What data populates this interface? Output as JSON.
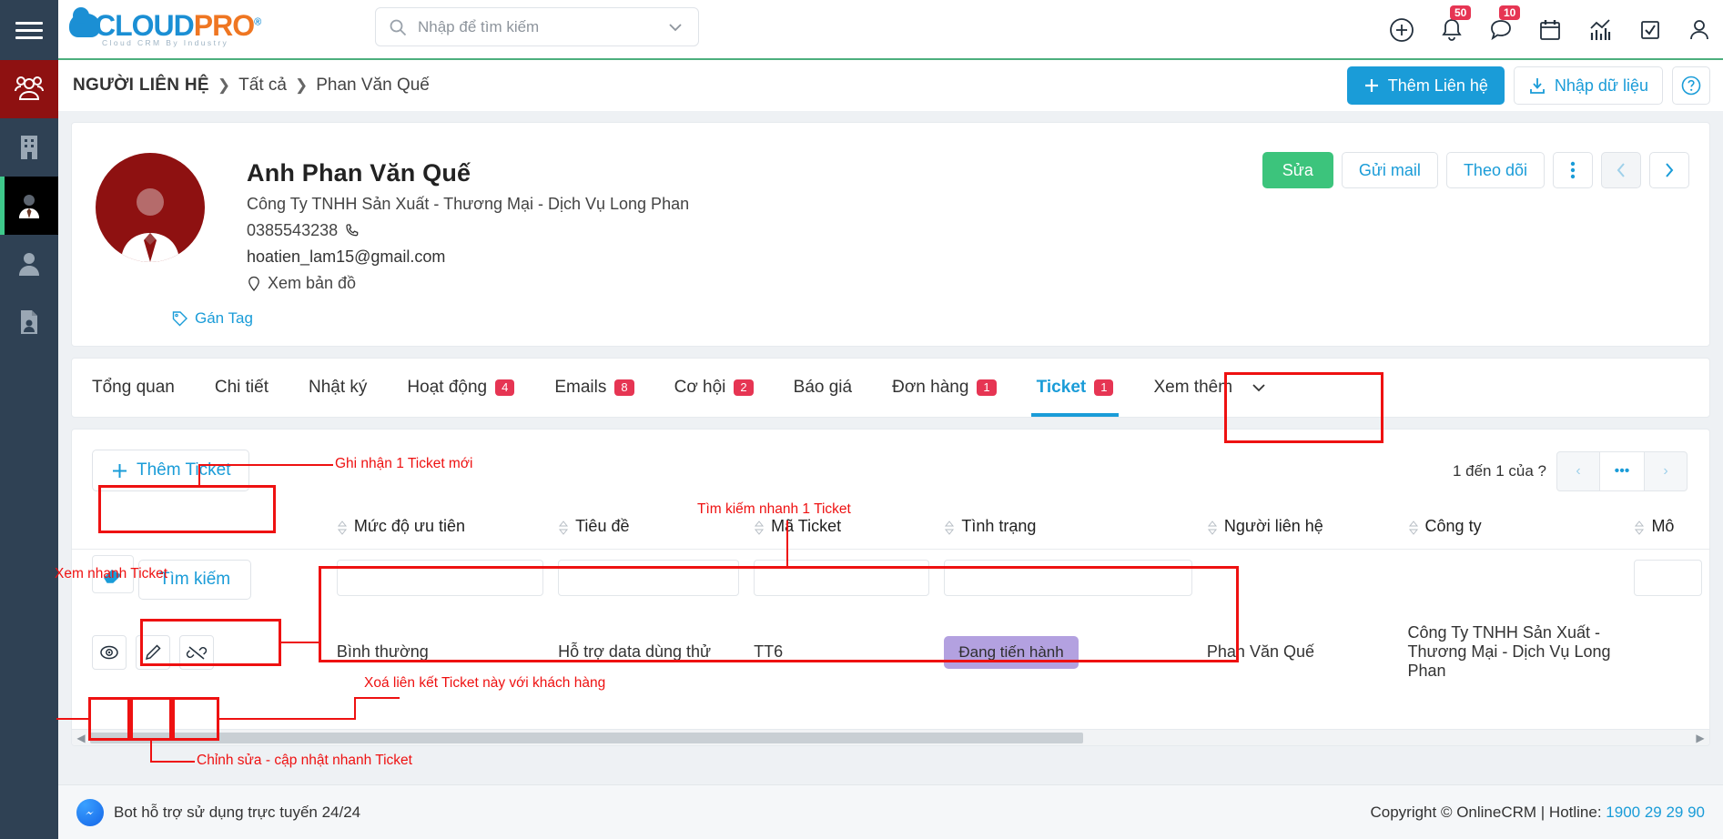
{
  "rail": {
    "items": [
      {
        "name": "menu-toggle",
        "icon": "hamburger-icon"
      },
      {
        "name": "contacts",
        "icon": "people-group-icon",
        "state": "active-red"
      },
      {
        "name": "companies",
        "icon": "building-icon",
        "state": "normal"
      },
      {
        "name": "persons",
        "icon": "person-tie-icon",
        "state": "active-black"
      },
      {
        "name": "users",
        "icon": "user-icon",
        "state": "normal"
      },
      {
        "name": "documents",
        "icon": "document-person-icon",
        "state": "normal"
      }
    ]
  },
  "header": {
    "logo_main": "CLOUD",
    "logo_accent": "PRO",
    "logo_reg": "®",
    "logo_tagline": "Cloud CRM By Industry",
    "search_placeholder": "Nhập để tìm kiếm",
    "search_value": "",
    "icons": [
      {
        "name": "add-circle-icon",
        "badge": null
      },
      {
        "name": "bell-icon",
        "badge": "50"
      },
      {
        "name": "chat-bubble-icon",
        "badge": "10"
      },
      {
        "name": "calendar-icon",
        "badge": null
      },
      {
        "name": "analytics-icon",
        "badge": null
      },
      {
        "name": "task-check-icon",
        "badge": null
      },
      {
        "name": "account-icon",
        "badge": null
      }
    ]
  },
  "breadcrumb": {
    "title": "NGƯỜI LIÊN HỆ",
    "sep": "❯",
    "items": [
      "Tất cả",
      "Phan Văn Quế"
    ],
    "actions": {
      "add_label": "Thêm Liên hệ",
      "import_label": "Nhập dữ liệu",
      "help_label": "?"
    }
  },
  "profile": {
    "name": "Anh Phan Văn Quế",
    "company": "Công Ty TNHH Sản Xuất - Thương Mại - Dịch Vụ Long Phan",
    "phone": "0385543238",
    "email": "hoatien_lam15@gmail.com",
    "map_label": "Xem bản đồ",
    "tag_label": "Gán Tag",
    "actions": {
      "edit": "Sửa",
      "send_mail": "Gửi mail",
      "follow": "Theo dõi",
      "more": "⋮",
      "prev": "‹",
      "next": "›"
    }
  },
  "tabs": [
    {
      "label": "Tổng quan",
      "badge": null,
      "active": false
    },
    {
      "label": "Chi tiết",
      "badge": null,
      "active": false
    },
    {
      "label": "Nhật ký",
      "badge": null,
      "active": false
    },
    {
      "label": "Hoạt động",
      "badge": "4",
      "active": false
    },
    {
      "label": "Emails",
      "badge": "8",
      "active": false
    },
    {
      "label": "Cơ hội",
      "badge": "2",
      "active": false
    },
    {
      "label": "Báo giá",
      "badge": null,
      "active": false
    },
    {
      "label": "Đơn hàng",
      "badge": "1",
      "active": false
    },
    {
      "label": "Ticket",
      "badge": "1",
      "active": true
    },
    {
      "label": "Xem thêm",
      "badge": null,
      "active": false
    }
  ],
  "panel": {
    "add_ticket_label": "Thêm Ticket",
    "search_button_label": "Tìm kiếm",
    "pagination": {
      "label": "1 đến 1 của ?",
      "prev": "‹",
      "mid": "•••",
      "next": "›"
    },
    "columns": [
      {
        "key": "actions",
        "label": ""
      },
      {
        "key": "priority",
        "label": "Mức độ ưu tiên"
      },
      {
        "key": "title",
        "label": "Tiêu đề"
      },
      {
        "key": "code",
        "label": "Mã Ticket"
      },
      {
        "key": "status",
        "label": "Tình trạng"
      },
      {
        "key": "contact",
        "label": "Người liên hệ"
      },
      {
        "key": "company",
        "label": "Công ty"
      },
      {
        "key": "desc",
        "label": "Mô"
      }
    ],
    "filters": {
      "priority": "",
      "title": "",
      "code": "",
      "status": "",
      "contact": "",
      "company": "",
      "desc": ""
    },
    "rows": [
      {
        "priority": "Bình thường",
        "title": "Hỗ trợ data dùng thử",
        "code": "TT6",
        "status": "Đang tiến hành",
        "contact": "Phan Văn Quế",
        "company": "Công Ty TNHH Sản Xuất - Thương Mại - Dịch Vụ Long Phan",
        "row_actions": [
          {
            "name": "view-icon",
            "title": "Xem"
          },
          {
            "name": "edit-pencil-icon",
            "title": "Sửa"
          },
          {
            "name": "unlink-icon",
            "title": "Xoá liên kết"
          }
        ]
      }
    ]
  },
  "annotations": [
    {
      "id": "a1",
      "text": "Ghi nhận 1 Ticket mới"
    },
    {
      "id": "a2",
      "text": "Tìm kiếm nhanh 1 Ticket"
    },
    {
      "id": "a3",
      "text": "Xem nhanh Ticket"
    },
    {
      "id": "a4",
      "text": "Xoá liên kết Ticket này với khách hàng"
    },
    {
      "id": "a5",
      "text": "Chỉnh sửa - cập nhật nhanh Ticket"
    }
  ],
  "footer": {
    "bot_label": "Bot hỗ trợ sử dụng trực tuyến 24/24",
    "copyright": "Copyright © OnlineCRM | Hotline: ",
    "hotline": "1900 29 29 90"
  },
  "colors": {
    "accent_blue": "#1a9cd8",
    "green": "#3cc47c",
    "badge_red": "#e63553",
    "rail_dark": "#2f4154",
    "avatar_red": "#8e1111",
    "status_purple": "#b3a1e0",
    "annotation_red": "#ee1111"
  }
}
